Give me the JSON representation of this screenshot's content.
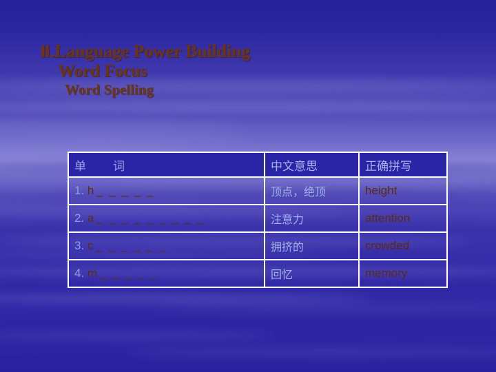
{
  "slide": {
    "title_lines": [
      {
        "numeral": "Ⅱ",
        "text": ".Language Power Building"
      },
      {
        "text": "Word Focus"
      },
      {
        "text": "Word Spelling"
      }
    ],
    "title_color": "#6d3410",
    "background_color": "#2f27a5"
  },
  "table": {
    "headers": {
      "word": "单",
      "word2": "词",
      "meaning": "中文意思",
      "spelling": "正确拼写"
    },
    "rows": [
      {
        "number": "1.",
        "letter": "h",
        "blanks": "_ _ _ _ _",
        "meaning": "顶点，绝顶",
        "spelling": "height"
      },
      {
        "number": "2.",
        "letter": "a",
        "blanks": "_ _ _ _ _ _ _ _ _",
        "meaning": "注意力",
        "spelling": "attention"
      },
      {
        "number": "3.",
        "letter": "c",
        "blanks": "_ _ _ _ _ _",
        "meaning": "拥挤的",
        "spelling": "crowded"
      },
      {
        "number": "4.",
        "letter": "m",
        "blanks": "_ _ _ _ _",
        "meaning": "回忆",
        "spelling": "memory"
      }
    ]
  }
}
